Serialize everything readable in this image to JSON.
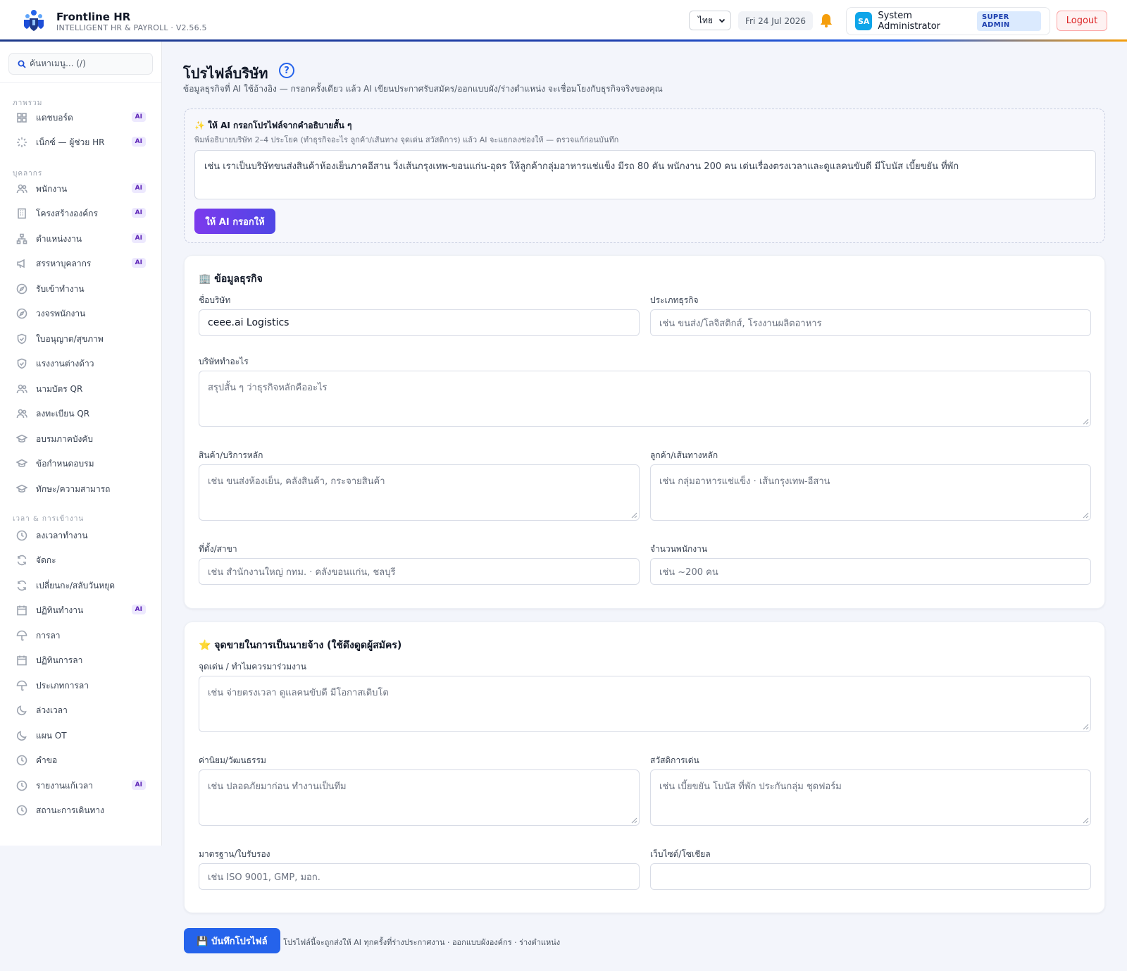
{
  "app": {
    "title": "Frontline HR",
    "subtitle": "INTELLIGENT HR & PAYROLL · V2.56.5",
    "language": "ไทย",
    "date": "Fri 24 Jul 2026",
    "user_initials": "SA",
    "user_name": "System Administrator",
    "user_role": "SUPER ADMIN",
    "logout_label": "Logout"
  },
  "sidebar": {
    "search_placeholder": "ค้นหาเมนู... (/)",
    "sections": [
      {
        "label": "ภาพรวม"
      },
      {
        "label": "บุคลากร"
      },
      {
        "label": "เวลา & การเข้างาน"
      }
    ],
    "items": [
      {
        "label": "แดชบอร์ด",
        "icon": "grid-icon",
        "ai": "AI"
      },
      {
        "label": "เน็กซ์ — ผู้ช่วย HR",
        "icon": "sparkle-icon",
        "ai": "AI"
      },
      {
        "label": "พนักงาน",
        "icon": "users-icon",
        "ai": "AI"
      },
      {
        "label": "โครงสร้างองค์กร",
        "icon": "building-icon",
        "ai": "AI"
      },
      {
        "label": "ตำแหน่งงาน",
        "icon": "org-chart-icon",
        "ai": "AI"
      },
      {
        "label": "สรรหาบุคลากร",
        "icon": "megaphone-icon",
        "ai": "AI"
      },
      {
        "label": "รับเข้าทำงาน",
        "icon": "compass-icon",
        "ai": null
      },
      {
        "label": "วงจรพนักงาน",
        "icon": "compass-icon",
        "ai": null
      },
      {
        "label": "ใบอนุญาต/สุขภาพ",
        "icon": "shield-icon",
        "ai": null
      },
      {
        "label": "แรงงานต่างด้าว",
        "icon": "shield-icon",
        "ai": null
      },
      {
        "label": "นามบัตร QR",
        "icon": "users-icon",
        "ai": null
      },
      {
        "label": "ลงทะเบียน QR",
        "icon": "users-icon",
        "ai": null
      },
      {
        "label": "อบรมภาคบังคับ",
        "icon": "graduation-cap-icon",
        "ai": null
      },
      {
        "label": "ข้อกำหนดอบรม",
        "icon": "graduation-cap-icon",
        "ai": null
      },
      {
        "label": "ทักษะ/ความสามารถ",
        "icon": "graduation-cap-icon",
        "ai": null
      },
      {
        "label": "ลงเวลาทำงาน",
        "icon": "clock-icon",
        "ai": null
      },
      {
        "label": "จัดกะ",
        "icon": "refresh-icon",
        "ai": null
      },
      {
        "label": "เปลี่ยนกะ/สลับวันหยุด",
        "icon": "refresh-icon",
        "ai": null
      },
      {
        "label": "ปฏิทินทำงาน",
        "icon": "calendar-icon",
        "ai": "AI"
      },
      {
        "label": "การลา",
        "icon": "umbrella-icon",
        "ai": null
      },
      {
        "label": "ปฏิทินการลา",
        "icon": "calendar-icon",
        "ai": null
      },
      {
        "label": "ประเภทการลา",
        "icon": "umbrella-icon",
        "ai": null
      },
      {
        "label": "ล่วงเวลา",
        "icon": "moon-icon",
        "ai": null
      },
      {
        "label": "แผน OT",
        "icon": "moon-icon",
        "ai": null
      },
      {
        "label": "คำขอ",
        "icon": "clock-icon",
        "ai": null
      },
      {
        "label": "รายงานแก้เวลา",
        "icon": "clock-icon",
        "ai": "AI"
      },
      {
        "label": "สถานะการเดินทาง",
        "icon": "clock-icon",
        "ai": null
      }
    ]
  },
  "page": {
    "title": "โปรไฟล์บริษัท",
    "help": "?",
    "subtitle": "ข้อมูลธุรกิจที่ AI ใช้อ้างอิง — กรอกครั้งเดียว แล้ว AI เขียนประกาศรับสมัคร/ออกแบบผัง/ร่างตำแหน่ง จะเชื่อมโยงกับธุรกิจจริงของคุณ"
  },
  "ai_fill": {
    "title": "✨ ให้ AI กรอกโปรไฟล์จากคำอธิบายสั้น ๆ",
    "hint": "พิมพ์อธิบายบริษัท 2–4 ประโยค (ทำธุรกิจอะไร ลูกค้า/เส้นทาง จุดเด่น สวัสดิการ) แล้ว AI จะแยกลงช่องให้ — ตรวจแก้ก่อนบันทึก",
    "placeholder": "เช่น เราเป็นบริษัทขนส่งสินค้าห้องเย็นภาคอีสาน วิ่งเส้นกรุงเทพ-ขอนแก่น-อุดร ให้ลูกค้ากลุ่มอาหารแช่แข็ง มีรถ 80 คัน พนักงาน 200 คน เด่นเรื่องตรงเวลาและดูแลคนขับดี มีโบนัส เบี้ยขยัน ที่พัก",
    "button": "ให้ AI กรอกให้"
  },
  "business": {
    "title": "🏢 ข้อมูลธุรกิจ",
    "company_name": {
      "label": "ชื่อบริษัท",
      "value": "ceee.ai Logistics"
    },
    "business_type": {
      "label": "ประเภทธุรกิจ",
      "placeholder": "เช่น ขนส่ง/โลจิสติกส์, โรงงานผลิตอาหาร"
    },
    "what_we_do": {
      "label": "บริษัททำอะไร",
      "placeholder": "สรุปสั้น ๆ ว่าธุรกิจหลักคืออะไร"
    },
    "products": {
      "label": "สินค้า/บริการหลัก",
      "placeholder": "เช่น ขนส่งห้องเย็น, คลังสินค้า, กระจายสินค้า"
    },
    "customers": {
      "label": "ลูกค้า/เส้นทางหลัก",
      "placeholder": "เช่น กลุ่มอาหารแช่แข็ง · เส้นกรุงเทพ-อีสาน"
    },
    "location": {
      "label": "ที่ตั้ง/สาขา",
      "placeholder": "เช่น สำนักงานใหญ่ กทม. · คลังขอนแก่น, ชลบุรี"
    },
    "headcount": {
      "label": "จำนวนพนักงาน",
      "placeholder": "เช่น ~200 คน"
    }
  },
  "employer": {
    "title": "⭐ จุดขายในการเป็นนายจ้าง (ใช้ดึงดูดผู้สมัคร)",
    "strengths": {
      "label": "จุดเด่น / ทำไมควรมาร่วมงาน",
      "placeholder": "เช่น จ่ายตรงเวลา ดูแลคนขับดี มีโอกาสเติบโต"
    },
    "values": {
      "label": "ค่านิยม/วัฒนธรรม",
      "placeholder": "เช่น ปลอดภัยมาก่อน ทำงานเป็นทีม"
    },
    "benefits": {
      "label": "สวัสดิการเด่น",
      "placeholder": "เช่น เบี้ยขยัน โบนัส ที่พัก ประกันกลุ่ม ชุดฟอร์ม"
    },
    "standards": {
      "label": "มาตรฐาน/ใบรับรอง",
      "placeholder": "เช่น ISO 9001, GMP, มอก."
    },
    "website": {
      "label": "เว็บไซต์/โซเชียล",
      "placeholder": ""
    }
  },
  "footer": {
    "save_button": "💾 บันทึกโปรไฟล์",
    "note": "โปรไฟล์นี้จะถูกส่งให้ AI ทุกครั้งที่ร่างประกาศงาน · ออกแบบผังองค์กร · ร่างตำแหน่ง"
  }
}
